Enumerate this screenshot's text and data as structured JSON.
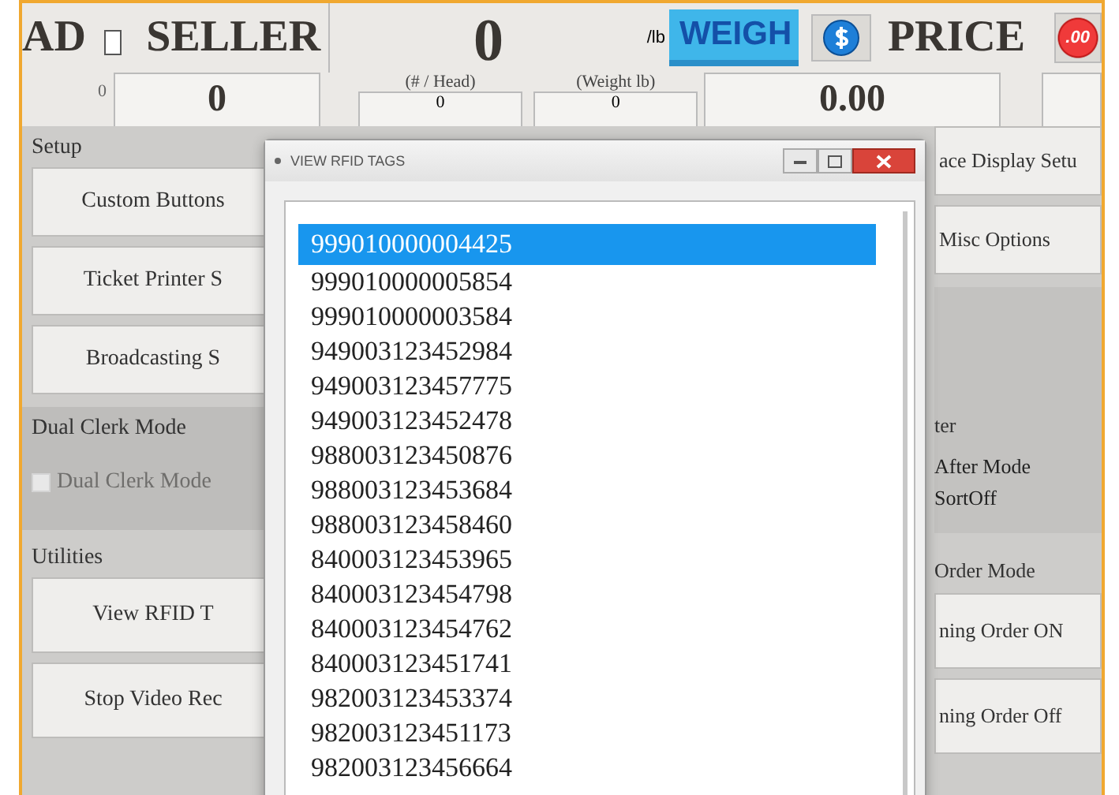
{
  "header": {
    "head_label": "AD",
    "head_checked": false,
    "seller_label": "SELLER",
    "seller_small": "0",
    "seller_value": "0",
    "weight_value": "0",
    "weight_unit": "/lb",
    "weigh_button": "WEIGH",
    "price_label": "PRICE",
    "decimal_button": ".00",
    "price_value": "0.00",
    "head_count": {
      "caption": "(# / Head)",
      "value": "0"
    },
    "head_weight": {
      "caption": "(Weight lb)",
      "value": "0"
    }
  },
  "setup": {
    "title": "Setup",
    "buttons": [
      "Custom Buttons",
      "Ticket Printer S",
      "Broadcasting S"
    ]
  },
  "dual_clerk": {
    "title": "Dual Clerk Mode",
    "checkbox": {
      "label": "Dual Clerk Mode",
      "checked": false,
      "disabled": true
    }
  },
  "utilities": {
    "title": "Utilities",
    "buttons": [
      "View RFID T",
      "Stop Video Rec"
    ]
  },
  "right_panel": {
    "buttons": [
      "ace Display Setu",
      "Misc Options"
    ],
    "sort_group": {
      "title": "ter",
      "lines": [
        "After Mode",
        "SortOff"
      ]
    },
    "order_group": {
      "title": "Order Mode",
      "buttons": [
        "ning Order ON",
        "ning Order Off"
      ]
    }
  },
  "dialog": {
    "title": "VIEW RFID TAGS",
    "tags": [
      {
        "text": "999010000004425",
        "selected": true
      },
      {
        "text": "999010000005854",
        "selected": false
      },
      {
        "text": "999010000003584",
        "selected": false
      },
      {
        "text": "949003123452984",
        "selected": false
      },
      {
        "text": "949003123457775",
        "selected": false
      },
      {
        "text": "949003123452478",
        "selected": false
      },
      {
        "text": "988003123450876",
        "selected": false
      },
      {
        "text": "988003123453684",
        "selected": false
      },
      {
        "text": "988003123458460",
        "selected": false
      },
      {
        "text": "840003123453965",
        "selected": false
      },
      {
        "text": "840003123454798",
        "selected": false
      },
      {
        "text": "840003123454762",
        "selected": false
      },
      {
        "text": "840003123451741",
        "selected": false
      },
      {
        "text": "982003123453374",
        "selected": false
      },
      {
        "text": "982003123451173",
        "selected": false
      },
      {
        "text": "982003123456664",
        "selected": false
      }
    ]
  }
}
